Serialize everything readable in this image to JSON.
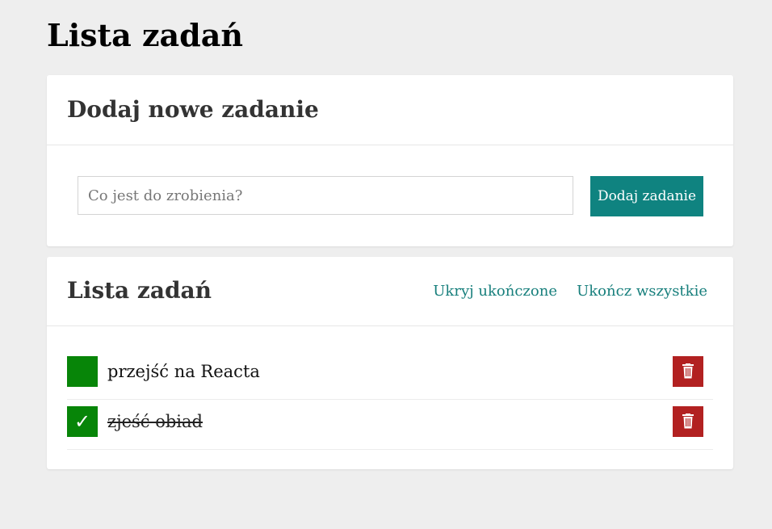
{
  "page": {
    "title": "Lista zadań"
  },
  "add_card": {
    "title": "Dodaj nowe zadanie",
    "input_placeholder": "Co jest do zrobienia?",
    "input_value": "",
    "button_label": "Dodaj zadanie"
  },
  "list_card": {
    "title": "Lista zadań",
    "hide_completed_label": "Ukryj ukończone",
    "complete_all_label": "Ukończ wszystkie",
    "tasks": [
      {
        "text": "przejść na Reacta",
        "done": false,
        "check_glyph": ""
      },
      {
        "text": "zjeść obiad",
        "done": true,
        "check_glyph": "✓"
      }
    ]
  },
  "colors": {
    "background": "#eeeeee",
    "accent": "#0f8380",
    "link": "#177f7c",
    "checkbox": "#078508",
    "delete": "#b22121"
  },
  "icons": {
    "delete": "trash-icon",
    "check": "checkmark-icon"
  }
}
